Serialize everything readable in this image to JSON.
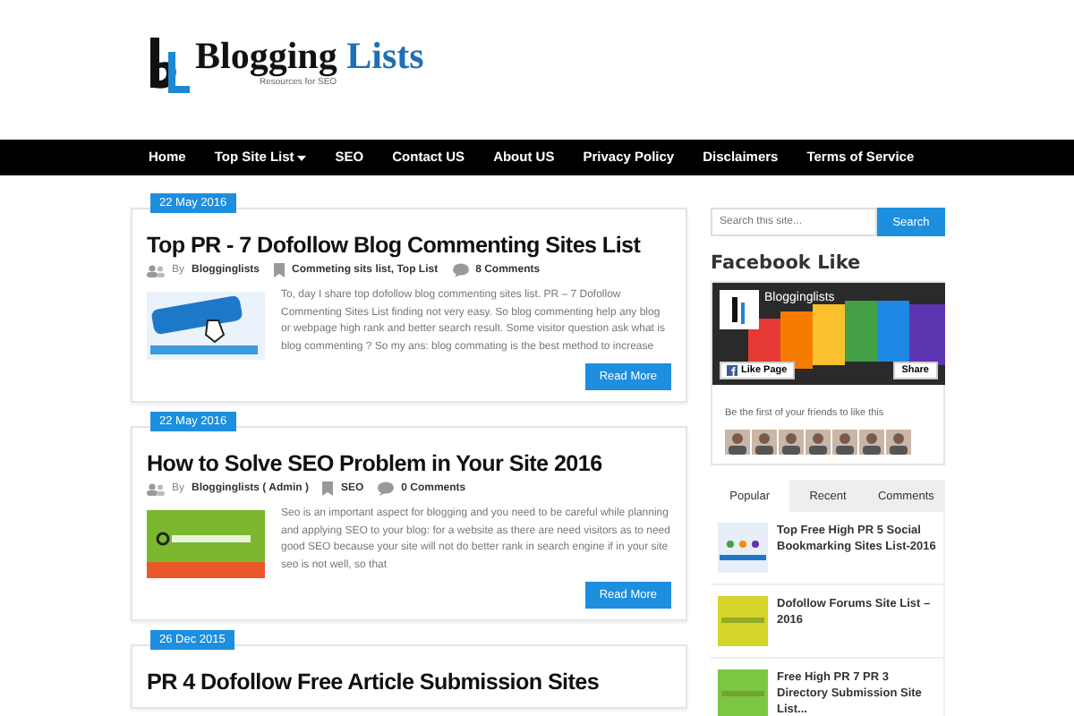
{
  "logo": {
    "name_part_1": "Blogging",
    "name_part_2": "Lists",
    "tagline": "Resources for SEO"
  },
  "nav": [
    {
      "label": "Home",
      "dropdown": false
    },
    {
      "label": "Top Site List",
      "dropdown": true
    },
    {
      "label": "SEO",
      "dropdown": false
    },
    {
      "label": "Contact US",
      "dropdown": false
    },
    {
      "label": "About US",
      "dropdown": false
    },
    {
      "label": "Privacy Policy",
      "dropdown": false
    },
    {
      "label": "Disclaimers",
      "dropdown": false
    },
    {
      "label": "Terms of Service",
      "dropdown": false
    }
  ],
  "posts": [
    {
      "date": "22 May 2016",
      "title": "Top PR - 7 Dofollow Blog Commenting Sites List",
      "by": "By",
      "author": "Blogginglists",
      "categories": "Commeting sits list, Top List",
      "comments": "8 Comments",
      "excerpt": "To, day I share top dofollow blog commenting sites list. PR – 7 Dofollow Commenting Sites List finding not very easy. So blog commenting help any blog or webpage high rank and better search result. Some visitor question ask what is blog commenting ? So my ans: blog commating is the best method to increase",
      "read_more": "Read More"
    },
    {
      "date": "22 May 2016",
      "title": "How to Solve SEO Problem in Your Site 2016",
      "by": "By",
      "author": "Blogginglists ( Admin )",
      "categories": "SEO",
      "comments": "0 Comments",
      "excerpt": "Seo is an important aspect for blogging and you need to be careful while planning and applying SEO to your blog: for a website as there are need visitors as to need good SEO because your site will not do better rank in search engine if in your site seo is not well, so that",
      "read_more": "Read More"
    },
    {
      "date": "26 Dec 2015",
      "title": "PR 4 Dofollow Free Article Submission Sites"
    }
  ],
  "search": {
    "placeholder": "Search this site...",
    "button": "Search"
  },
  "facebook": {
    "heading": "Facebook Like",
    "page_name": "Blogginglists",
    "like_button": "Like Page",
    "share_button": "Share",
    "friends_text": "Be the first of your friends to like this"
  },
  "tabs": [
    {
      "label": "Popular",
      "selected": true
    },
    {
      "label": "Recent",
      "selected": false
    },
    {
      "label": "Comments",
      "selected": false
    }
  ],
  "popular": [
    {
      "title": "Top Free High PR 5 Social Bookmarking Sites List-2016"
    },
    {
      "title": "Dofollow Forums Site List – 2016"
    },
    {
      "title": "Free High PR 7 PR 3 Directory Submission Site List..."
    }
  ]
}
